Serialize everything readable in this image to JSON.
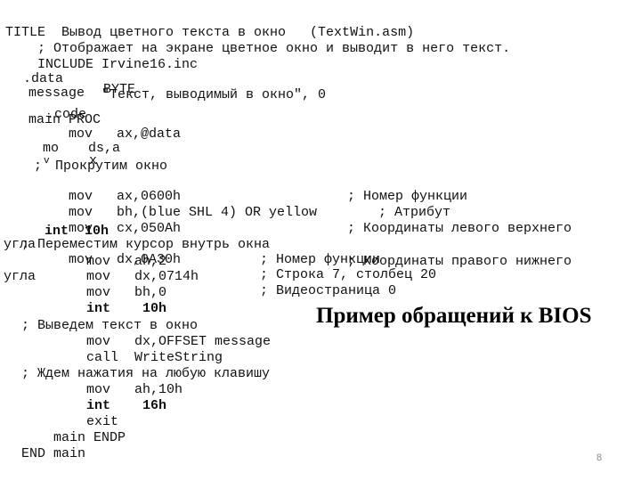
{
  "slide": {
    "heading": "Пример обращений к BIOS",
    "page_number": "8",
    "code": {
      "title_line": "TITLE  Вывод цветного текста в окно   (TextWin.asm)",
      "comment_intro": "; Отображает на экране цветное окно и выводит в него текст.",
      "include_line": "INCLUDE Irvine16.inc",
      "data_directive": ".data",
      "message_label": "message",
      "byte_keyword": "BYTE",
      "message_string": "\"Текст, выводимый в окно\", 0",
      "code_directive": ".code",
      "main_proc": "main PROC",
      "mov_ax_data": "mov   ax,@data",
      "mov_ds_frag1": "mo",
      "mov_ds_frag2": "ds,a",
      "mov_ds_frag_v": "v",
      "mov_ds_frag_x": "x",
      "comment_scroll_semicolon": ";",
      "comment_scroll": "Прокрутим окно",
      "mov_ax_0600": "mov   ax,0600h",
      "comment_func_no": "; Номер функции",
      "mov_bh_attr": "mov   bh,(blue SHL 4) OR yellow",
      "comment_attr": "; Атрибут",
      "mov_cx_050a": "mov   cx,050Ah",
      "comment_upper_left": "; Координаты левого верхнего",
      "int_10h_overlap": "int  10h",
      "corner_word_1": "угла",
      "comment_move_cursor": "; Переместим курсор внутрь окна",
      "mov_dx_0a30": "mov   dx,0A30h",
      "mov_ah_2": "mov   ah,2",
      "comment_func_no_2": "; Номер функции",
      "comment_lower_right": "; Координаты правого нижнего",
      "corner_word_2": "угла",
      "mov_dx_0714": "mov   dx,0714h",
      "comment_row_col": "; Строка 7, столбец 20",
      "mov_bh_0": "mov   bh,0",
      "comment_video_page": "; Видеостраница 0",
      "int_kw": "int",
      "int_10h_val": "10h",
      "comment_output_text": "; Выведем текст в окно",
      "mov_dx_offset": "mov   dx,OFFSET message",
      "call_writestring": "call  WriteString",
      "comment_wait_key": "; Ждем нажатия на любую клавишу",
      "mov_ah_10h": "mov   ah,10h",
      "int_16h_val": "16h",
      "exit_line": "exit",
      "main_endp": "main ENDP",
      "end_main": "END main"
    }
  }
}
